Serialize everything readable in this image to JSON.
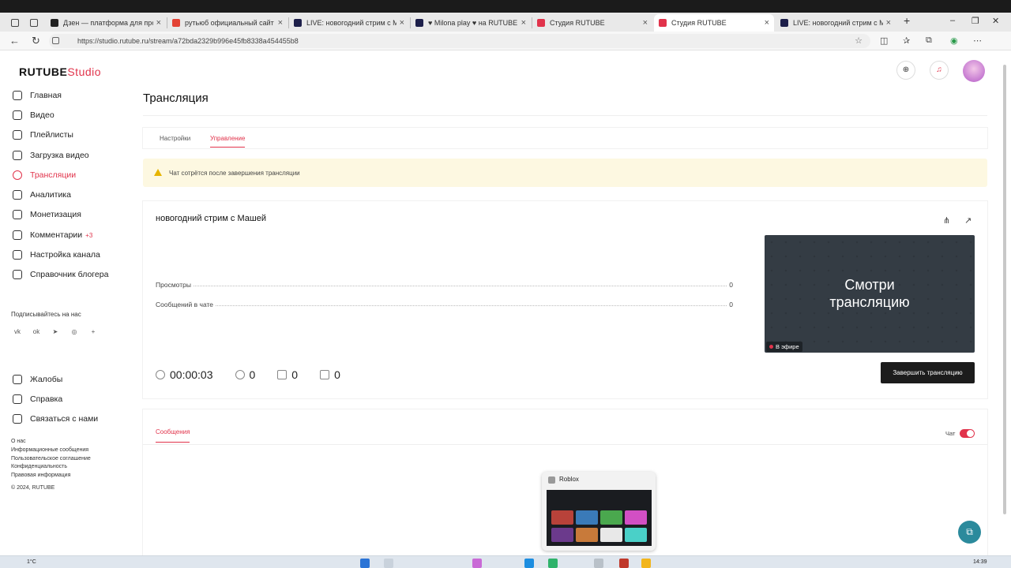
{
  "browser": {
    "tabs": [
      {
        "title": "Дзен — платформа для просм",
        "color": "#222"
      },
      {
        "title": "рутьюб официальный сайт —",
        "color": "#e34234"
      },
      {
        "title": "LIVE: новогодний стрим с Маш",
        "color": "#1d1f4a"
      },
      {
        "title": "♥ Milona play ♥ на RUTUBE: I",
        "color": "#1d1f4a"
      },
      {
        "title": "Студия RUTUBE",
        "color": "#e1334b"
      },
      {
        "title": "Студия RUTUBE",
        "color": "#e1334b"
      },
      {
        "title": "LIVE: новогодний стрим с Маш",
        "color": "#1d1f4a"
      }
    ],
    "url": "https://studio.rutube.ru/stream/a72bda2329b996e45fb8338a454455b8"
  },
  "logo": {
    "brand": "RUTUBE",
    "product": "Studio"
  },
  "sidebar": {
    "items": [
      {
        "label": "Главная"
      },
      {
        "label": "Видео"
      },
      {
        "label": "Плейлисты"
      },
      {
        "label": "Загрузка видео"
      },
      {
        "label": "Трансляции"
      },
      {
        "label": "Аналитика"
      },
      {
        "label": "Монетизация"
      },
      {
        "label": "Комментарии",
        "badge": "+3"
      },
      {
        "label": "Настройка канала"
      },
      {
        "label": "Справочник блогера"
      }
    ],
    "subscribe_label": "Подписывайтесь на нас",
    "socials": [
      "vk",
      "ok",
      "telegram",
      "viber",
      "more"
    ],
    "bottom_items": [
      {
        "label": "Жалобы"
      },
      {
        "label": "Справка"
      },
      {
        "label": "Связаться с нами"
      }
    ],
    "footer_links": [
      "О нас",
      "Информационные сообщения",
      "Пользовательское соглашение",
      "Конфиденциальность",
      "Правовая информация"
    ],
    "copyright": "© 2024, RUTUBE"
  },
  "page": {
    "title": "Трансляция",
    "tabs": {
      "settings": "Настройки",
      "management": "Управление"
    },
    "warning": "Чат сотрётся после завершения трансляции",
    "stream": {
      "title": "новогодний стрим с Машей",
      "views_label": "Просмотры",
      "views_value": "0",
      "chat_msgs_label": "Сообщений в чате",
      "chat_msgs_value": "0",
      "timer": "00:00:03",
      "viewers": "0",
      "likes": "0",
      "dislikes": "0",
      "preview_text_1": "Смотри",
      "preview_text_2": "трансляцию",
      "live_badge": "В эфире",
      "end_button": "Завершить трансляцию"
    },
    "chat": {
      "tab_label": "Сообщения",
      "toggle_label": "Чат",
      "toggle_on": true
    }
  },
  "popup": {
    "title": "Roblox"
  },
  "taskbar": {
    "temp": "1°C",
    "time": "14:39"
  },
  "colors": {
    "accent": "#e1334b",
    "dark": "#1c1c1c",
    "warning_bg": "#fdf8e1",
    "help": "#2b8a9c"
  }
}
